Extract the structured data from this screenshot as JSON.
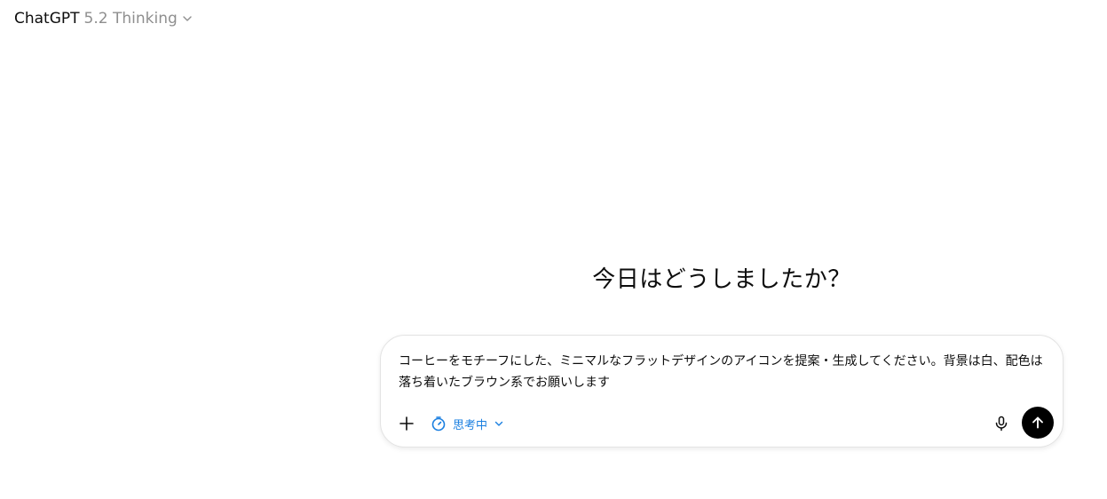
{
  "header": {
    "model_name": "ChatGPT",
    "model_version": "5.2 Thinking"
  },
  "main": {
    "greeting": "今日はどうしましたか？"
  },
  "composer": {
    "input_text": "コーヒーをモチーフにした、ミニマルなフラットデザインのアイコンを提案・生成してください。背景は白、配色は落ち着いたブラウン系でお願いします",
    "thinking_label": "思考中"
  },
  "colors": {
    "accent": "#1a7fe0",
    "send_button": "#000000",
    "muted_text": "#8f8f8f"
  },
  "icons": {
    "model_chevron": "chevron-down-icon",
    "plus": "plus-icon",
    "thinking": "timer-icon",
    "thinking_chevron": "chevron-down-icon",
    "mic": "microphone-icon",
    "send": "arrow-up-icon"
  }
}
